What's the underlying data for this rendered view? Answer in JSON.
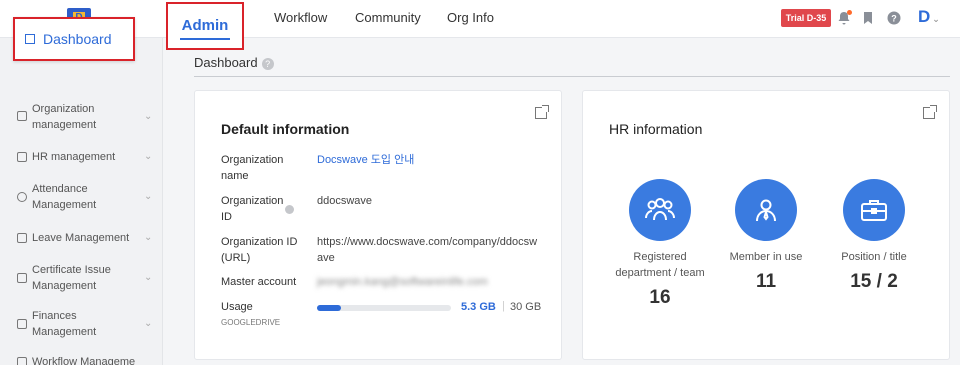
{
  "header": {
    "logo_letter": "D",
    "tabs": [
      {
        "label": "Admin"
      },
      {
        "label": "Workflow"
      },
      {
        "label": "Community"
      },
      {
        "label": "Org Info"
      }
    ],
    "trial_badge": "Trial D-35",
    "user_logo": "D",
    "colors": {
      "accent": "#2e6bd8",
      "trial": "#e0474c",
      "highlight_box": "#d9232a"
    }
  },
  "sidebar": {
    "active": "Dashboard",
    "items": [
      {
        "label": "Organization management",
        "icon": "org-chart-icon"
      },
      {
        "label": "HR management",
        "icon": "people-icon"
      },
      {
        "label": "Attendance Management",
        "icon": "clock-icon"
      },
      {
        "label": "Leave Management",
        "icon": "calendar-icon"
      },
      {
        "label": "Certificate Issue Management",
        "icon": "certificate-icon"
      },
      {
        "label": "Finances Management",
        "icon": "document-icon"
      },
      {
        "label": "Workflow Manageme",
        "icon": "workflow-icon"
      }
    ]
  },
  "main": {
    "title": "Dashboard",
    "default_info": {
      "title": "Default information",
      "org_name_label": "Organization name",
      "org_name_value": "Docswave 도입 안내",
      "org_id_label": "Organization ID",
      "org_id_value": "ddocswave",
      "org_url_label": "Organization ID (URL)",
      "org_url_value": "https://www.docswave.com/company/ddocswave",
      "master_label": "Master account",
      "master_value": "jeongmin.kang@softwareinlife.com",
      "usage_label": "Usage",
      "usage_sub": "GOOGLEDRIVE",
      "usage_used": "5.3 GB",
      "usage_sep": "|",
      "usage_total": "30 GB",
      "usage_fraction": 0.18
    },
    "hr_info": {
      "title": "HR information",
      "stats": [
        {
          "label": "Registered department / team",
          "value": "16",
          "icon": "team-icon"
        },
        {
          "label": "Member in use",
          "value": "11",
          "icon": "member-icon"
        },
        {
          "label": "Position / title",
          "value": "15 / 2",
          "icon": "briefcase-icon"
        }
      ]
    }
  }
}
